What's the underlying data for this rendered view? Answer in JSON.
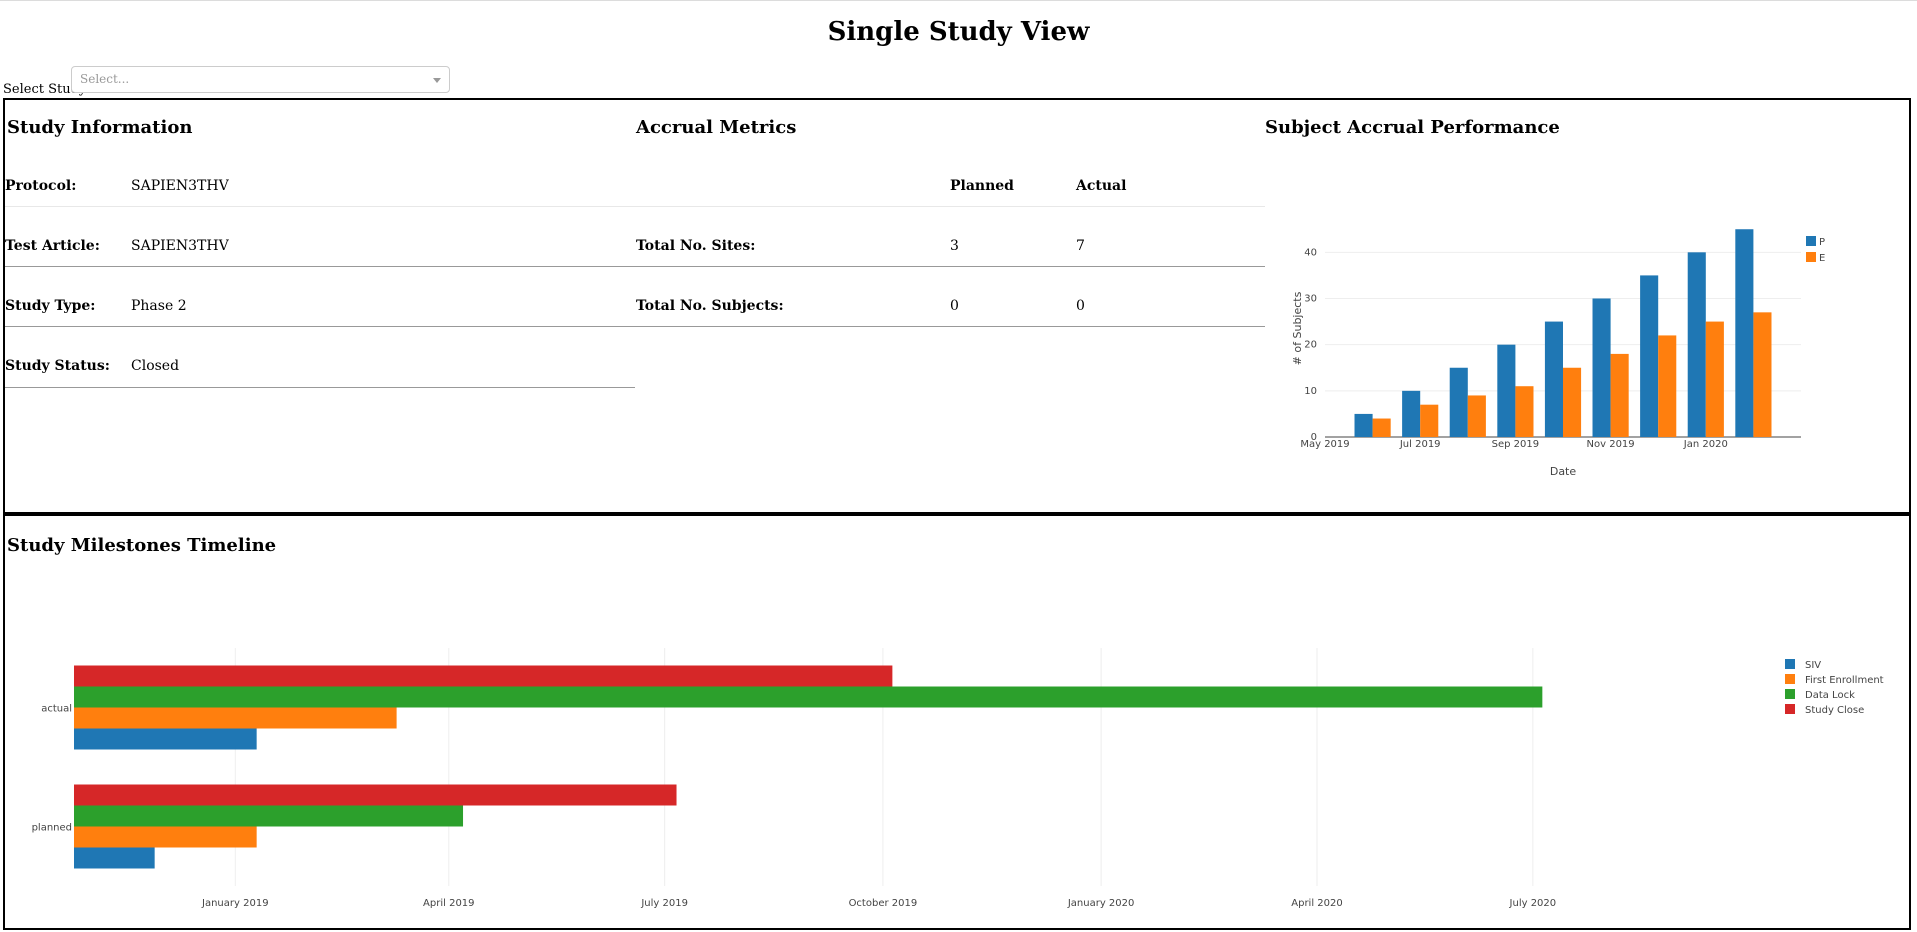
{
  "page": {
    "title": "Single Study View"
  },
  "study_select": {
    "label": "Select Study:",
    "placeholder": "Select..."
  },
  "study_info": {
    "title": "Study Information",
    "rows": [
      {
        "label": "Protocol:",
        "value": "SAPIEN3THV"
      },
      {
        "label": "Test Article:",
        "value": "SAPIEN3THV"
      },
      {
        "label": "Study Type:",
        "value": "Phase 2"
      },
      {
        "label": "Study Status:",
        "value": "Closed"
      }
    ]
  },
  "accrual_metrics": {
    "title": "Accrual Metrics",
    "headers": [
      "Planned",
      "Actual"
    ],
    "rows": [
      {
        "label": "Total No. Sites:",
        "planned": "3",
        "actual": "7"
      },
      {
        "label": "Total No. Subjects:",
        "planned": "0",
        "actual": "0"
      }
    ]
  },
  "accrual_performance": {
    "title": "Subject Accrual Performance"
  },
  "milestones": {
    "title": "Study Milestones Timeline"
  },
  "chart_data": [
    {
      "type": "bar",
      "xlabel": "Date",
      "ylabel": "# of Subjects",
      "x_tick_labels": [
        "May 2019",
        "Jul 2019",
        "Sep 2019",
        "Nov 2019",
        "Jan 2020"
      ],
      "x_range": [
        "2019-05",
        "2020-03"
      ],
      "ylim": [
        0,
        47
      ],
      "yticks": [
        0,
        10,
        20,
        30,
        40
      ],
      "categories": [
        "2019-06",
        "2019-07",
        "2019-08",
        "2019-09",
        "2019-10",
        "2019-11",
        "2019-12",
        "2020-01",
        "2020-02"
      ],
      "series": [
        {
          "name": "Planned",
          "color": "#1f77b4",
          "values": [
            5,
            10,
            15,
            20,
            25,
            30,
            35,
            40,
            45
          ]
        },
        {
          "name": "Enrolled",
          "color": "#ff7f0e",
          "values": [
            4,
            7,
            9,
            11,
            15,
            18,
            22,
            25,
            27
          ]
        }
      ],
      "legend": "top-right",
      "grid": true
    },
    {
      "type": "bar",
      "orientation": "horizontal",
      "xlabel": "Date",
      "x_tick_labels": [
        "January 2019",
        "April 2019",
        "July 2019",
        "October 2019",
        "January 2020",
        "April 2020",
        "July 2020"
      ],
      "x_range": [
        "2018-10-25",
        "2020-09-20"
      ],
      "categories": [
        "actual",
        "planned"
      ],
      "series": [
        {
          "name": "SIV",
          "color": "#1f77b4",
          "values": [
            "2019-01-10",
            "2018-11-28"
          ]
        },
        {
          "name": "First Enrollment",
          "color": "#ff7f0e",
          "values": [
            "2019-03-10",
            "2019-01-10"
          ]
        },
        {
          "name": "Data Lock",
          "color": "#2ca02c",
          "values": [
            "2020-07-05",
            "2019-04-07"
          ]
        },
        {
          "name": "Study Close",
          "color": "#d62728",
          "values": [
            "2019-10-05",
            "2019-07-06"
          ]
        }
      ],
      "legend": "top-right",
      "grid": true
    }
  ]
}
